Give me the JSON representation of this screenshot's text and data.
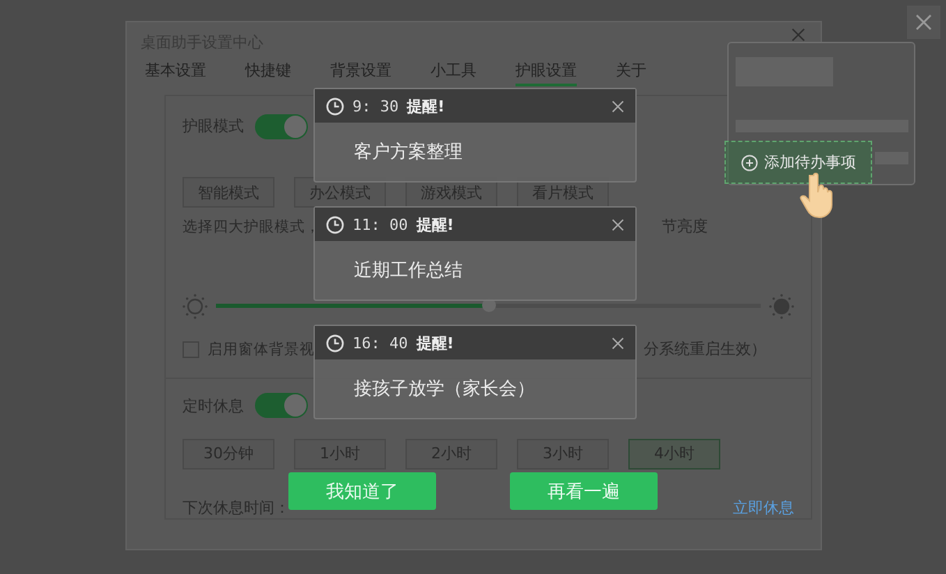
{
  "window": {
    "title": "桌面助手设置中心"
  },
  "tabs": [
    {
      "label": "基本设置",
      "selected": false
    },
    {
      "label": "快捷键",
      "selected": false
    },
    {
      "label": "背景设置",
      "selected": false
    },
    {
      "label": "小工具",
      "selected": false
    },
    {
      "label": "护眼设置",
      "selected": true
    },
    {
      "label": "关于",
      "selected": false
    }
  ],
  "eye_mode": {
    "label": "护眼模式",
    "on": true
  },
  "modes": [
    {
      "label": "智能模式",
      "selected": false
    },
    {
      "label": "办公模式",
      "selected": false
    },
    {
      "label": "游戏模式",
      "selected": false
    },
    {
      "label": "看片模式",
      "selected": false
    }
  ],
  "description": {
    "visible_start": "选择四大护眼模式，",
    "visible_end": "节亮度"
  },
  "brightness": {
    "level": 0.5
  },
  "background_option": {
    "checked": false,
    "visible_start": "启用窗体背景视",
    "visible_end": "分系统重启生效）"
  },
  "timed_rest": {
    "label": "定时休息",
    "on": true
  },
  "durations": [
    {
      "label": "30分钟",
      "selected": false
    },
    {
      "label": "1小时",
      "selected": false
    },
    {
      "label": "2小时",
      "selected": false
    },
    {
      "label": "3小时",
      "selected": false
    },
    {
      "label": "4小时",
      "selected": true
    }
  ],
  "next_rest": {
    "label": "下次休息时间："
  },
  "rest_now_link": "立即休息",
  "reminders": [
    {
      "time": "9: 30",
      "title": "提醒!",
      "text": "客户方案整理"
    },
    {
      "time": "11: 00",
      "title": "提醒!",
      "text": "近期工作总结"
    },
    {
      "time": "16: 40",
      "title": "提醒!",
      "text": "接孩子放学（家长会）"
    }
  ],
  "actions": [
    "我知道了",
    "再看一遍"
  ],
  "todo_widget": {
    "add_button": "添加待办事项"
  }
}
